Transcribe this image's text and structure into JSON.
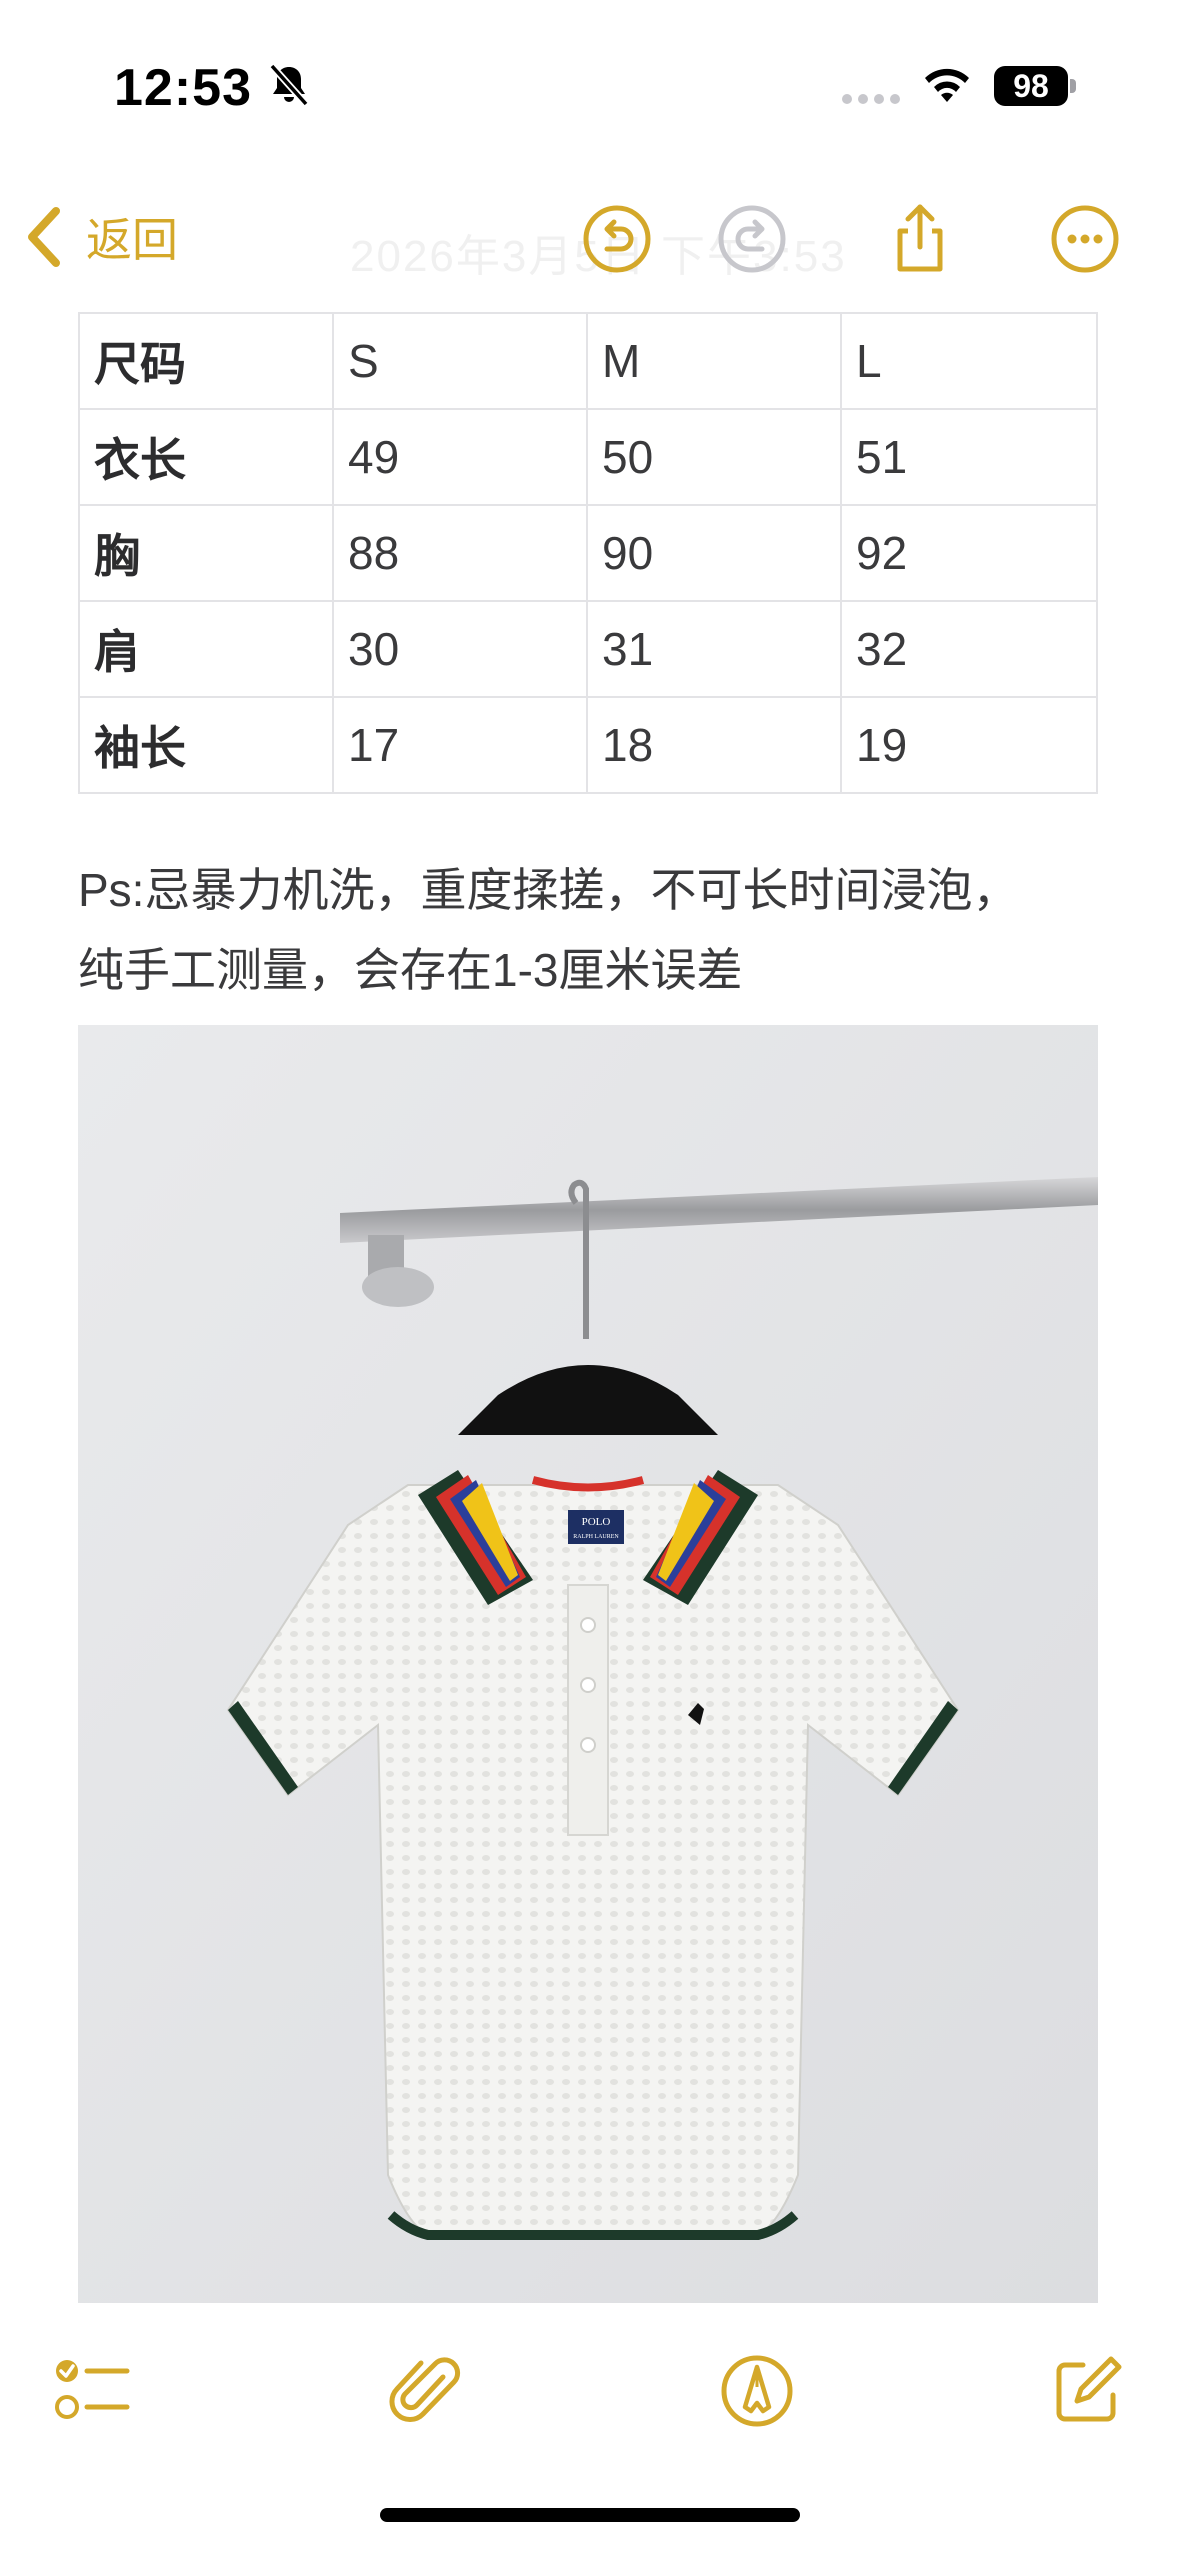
{
  "status_bar": {
    "time": "12:53",
    "battery": "98",
    "icons": [
      "bell-slash-icon",
      "cellular-dots-icon",
      "wifi-icon",
      "battery-icon"
    ]
  },
  "nav": {
    "back_label": "返回",
    "title_faded": "2026年3月5日 下午3:53",
    "icons": [
      "chevron-left-icon",
      "undo-icon",
      "redo-icon",
      "share-icon",
      "more-icon"
    ],
    "accent_color": "#d4a82a",
    "disabled_color": "#c7c7cc"
  },
  "size_table": {
    "rows": [
      [
        "尺码",
        "S",
        "M",
        "L"
      ],
      [
        "衣长",
        "49",
        "50",
        "51"
      ],
      [
        "胸",
        "88",
        "90",
        "92"
      ],
      [
        "肩",
        "30",
        "31",
        "32"
      ],
      [
        "袖长",
        "17",
        "18",
        "19"
      ]
    ]
  },
  "note": {
    "line1": "Ps:忌暴力机洗，重度揉搓，不可长时间浸泡，",
    "line2": "纯手工测量，会存在1-3厘米误差"
  },
  "photo": {
    "subject": "white knit polo shirt with striped collar on hanger",
    "label_text": "POLO",
    "label_subtext": "RALPH LAUREN"
  },
  "toolbar": {
    "icons": [
      "checklist-icon",
      "paperclip-icon",
      "markup-pen-icon",
      "compose-icon"
    ]
  }
}
